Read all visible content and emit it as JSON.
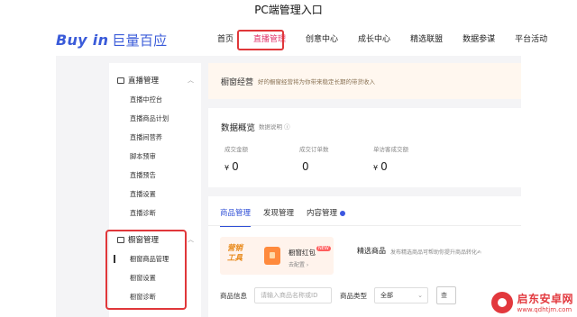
{
  "caption": "PC端管理入口",
  "brand": {
    "en": "Buy in",
    "cn": "巨量百应"
  },
  "nav": [
    "首页",
    "直播管理",
    "创意中心",
    "成长中心",
    "精选联盟",
    "数据参谋",
    "平台活动"
  ],
  "sidebar": {
    "live": {
      "title": "直播管理",
      "items": [
        "直播中控台",
        "直播商品计划",
        "直播间营养",
        "脚本预审",
        "直播预告",
        "直播设置",
        "直播诊断"
      ]
    },
    "window": {
      "title": "橱窗管理",
      "items": [
        "橱窗商品管理",
        "橱窗设置",
        "橱窗诊断"
      ]
    }
  },
  "banner": {
    "title": "橱窗经营",
    "subtitle": "好的橱窗经营将为你带来稳定长期的带货收入"
  },
  "overview": {
    "title": "数据概览",
    "note": "数据说明 ⓘ",
    "stats": [
      {
        "label": "成交金额",
        "currency": "¥",
        "value": "0"
      },
      {
        "label": "成交订单数",
        "currency": "",
        "value": "0"
      },
      {
        "label": "单访客成交额",
        "currency": "¥",
        "value": "0"
      }
    ]
  },
  "goods": {
    "tabs": [
      "商品管理",
      "发现管理",
      "内容管理"
    ],
    "promo": {
      "tag_line1": "营销",
      "tag_line2": "工具",
      "title": "橱窗红包",
      "badge": "NEW",
      "sub": "去配置 ›"
    },
    "select_title": "精选商品",
    "select_desc": "发布精选商品可帮助你提升商品转化✍",
    "form": {
      "name_label": "商品信息",
      "name_placeholder": "请输入商品名称或ID",
      "type_label": "商品类型",
      "type_value": "全部",
      "btn": "查"
    }
  },
  "watermark": {
    "cn": "启东安卓网",
    "url": "www.qdhtjm.com"
  },
  "colors": {
    "accent": "#e1366c",
    "highlight": "#e0373a",
    "primary": "#2f4fd6"
  }
}
